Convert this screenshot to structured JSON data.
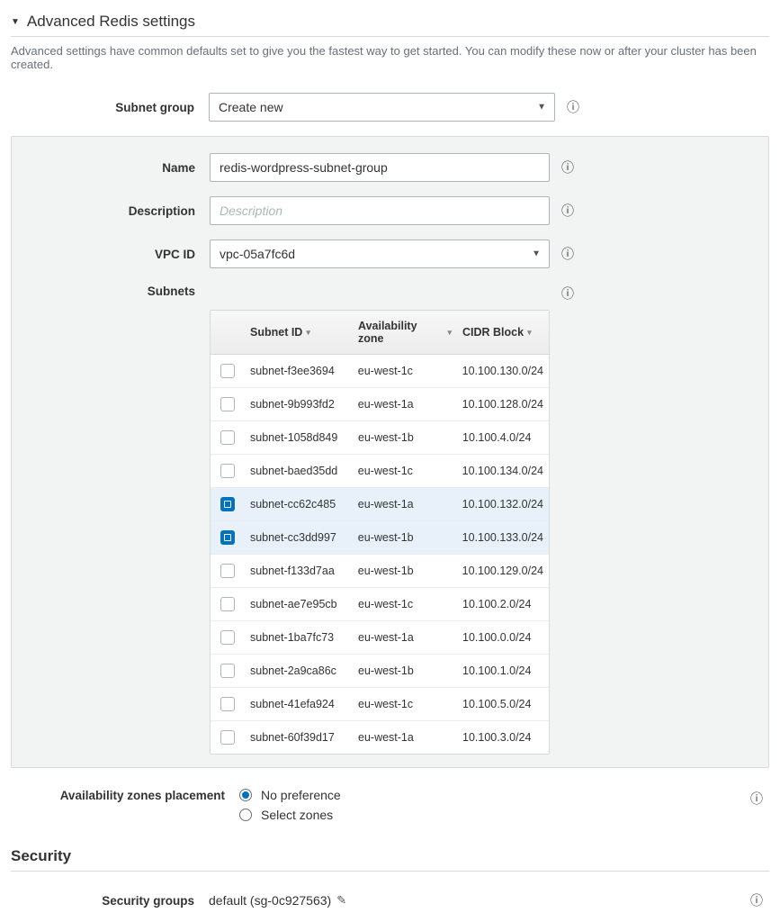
{
  "header": {
    "title": "Advanced Redis settings",
    "description": "Advanced settings have common defaults set to give you the fastest way to get started. You can modify these now or after your cluster has been created."
  },
  "subnet_group": {
    "label": "Subnet group",
    "selected": "Create new"
  },
  "panel": {
    "name": {
      "label": "Name",
      "value": "redis-wordpress-subnet-group"
    },
    "description": {
      "label": "Description",
      "placeholder": "Description",
      "value": ""
    },
    "vpc": {
      "label": "VPC ID",
      "selected": "vpc-05a7fc6d"
    },
    "subnets": {
      "label": "Subnets",
      "columns": {
        "subnet_id": "Subnet ID",
        "az": "Availability zone",
        "cidr": "CIDR Block"
      },
      "rows": [
        {
          "id": "subnet-f3ee3694",
          "az": "eu-west-1c",
          "cidr": "10.100.130.0/24",
          "checked": false
        },
        {
          "id": "subnet-9b993fd2",
          "az": "eu-west-1a",
          "cidr": "10.100.128.0/24",
          "checked": false
        },
        {
          "id": "subnet-1058d849",
          "az": "eu-west-1b",
          "cidr": "10.100.4.0/24",
          "checked": false
        },
        {
          "id": "subnet-baed35dd",
          "az": "eu-west-1c",
          "cidr": "10.100.134.0/24",
          "checked": false
        },
        {
          "id": "subnet-cc62c485",
          "az": "eu-west-1a",
          "cidr": "10.100.132.0/24",
          "checked": true
        },
        {
          "id": "subnet-cc3dd997",
          "az": "eu-west-1b",
          "cidr": "10.100.133.0/24",
          "checked": true
        },
        {
          "id": "subnet-f133d7aa",
          "az": "eu-west-1b",
          "cidr": "10.100.129.0/24",
          "checked": false
        },
        {
          "id": "subnet-ae7e95cb",
          "az": "eu-west-1c",
          "cidr": "10.100.2.0/24",
          "checked": false
        },
        {
          "id": "subnet-1ba7fc73",
          "az": "eu-west-1a",
          "cidr": "10.100.0.0/24",
          "checked": false
        },
        {
          "id": "subnet-2a9ca86c",
          "az": "eu-west-1b",
          "cidr": "10.100.1.0/24",
          "checked": false
        },
        {
          "id": "subnet-41efa924",
          "az": "eu-west-1c",
          "cidr": "10.100.5.0/24",
          "checked": false
        },
        {
          "id": "subnet-60f39d17",
          "az": "eu-west-1a",
          "cidr": "10.100.3.0/24",
          "checked": false
        }
      ]
    }
  },
  "az_placement": {
    "label": "Availability zones placement",
    "options": {
      "no_pref": "No preference",
      "select": "Select zones"
    },
    "selected": "no_pref"
  },
  "security": {
    "title": "Security",
    "groups": {
      "label": "Security groups",
      "value": "default (sg-0c927563)"
    }
  }
}
